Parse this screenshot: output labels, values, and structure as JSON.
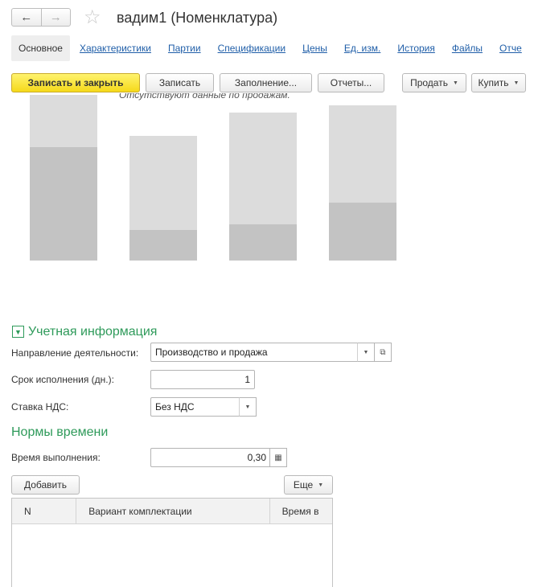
{
  "window": {
    "title": "вадим1 (Номенклатура)"
  },
  "nav": {
    "back_glyph": "←",
    "forward_glyph": "→",
    "favorite_glyph": "☆"
  },
  "tabs": [
    {
      "label": "Основное",
      "active": true
    },
    {
      "label": "Характеристики"
    },
    {
      "label": "Партии"
    },
    {
      "label": "Спецификации"
    },
    {
      "label": "Цены"
    },
    {
      "label": "Ед. изм."
    },
    {
      "label": "История"
    },
    {
      "label": "Файлы"
    },
    {
      "label": "Отче"
    }
  ],
  "toolbar": {
    "save_close": "Записать и закрыть",
    "save": "Записать",
    "fill": "Заполнение...",
    "reports": "Отчеты...",
    "sell": "Продать",
    "buy": "Купить"
  },
  "chart": {
    "message": "Отсутствуют данные по продажам.",
    "bars": [
      {
        "total": 0.92,
        "part": 0.63
      },
      {
        "total": 0.69,
        "part": 0.17
      },
      {
        "total": 0.82,
        "part": 0.2
      },
      {
        "total": 0.86,
        "part": 0.32
      }
    ]
  },
  "accounting": {
    "group_title": "Учетная информация",
    "direction_label": "Направление деятельности:",
    "direction_value": "Производство и продажа",
    "term_label": "Срок исполнения (дн.):",
    "term_value": "1",
    "vat_label": "Ставка НДС:",
    "vat_value": "Без НДС"
  },
  "time_norms": {
    "title": "Нормы времени",
    "exec_time_label": "Время выполнения:",
    "exec_time_value": "0,30",
    "add_button": "Добавить",
    "more_button": "Еще",
    "columns": [
      "N",
      "Вариант комплектации",
      "Время в"
    ]
  },
  "colors": {
    "accent_green": "#2e9a5a",
    "link_blue": "#1f5ea8",
    "primary_yellow": "#f5d91a"
  }
}
